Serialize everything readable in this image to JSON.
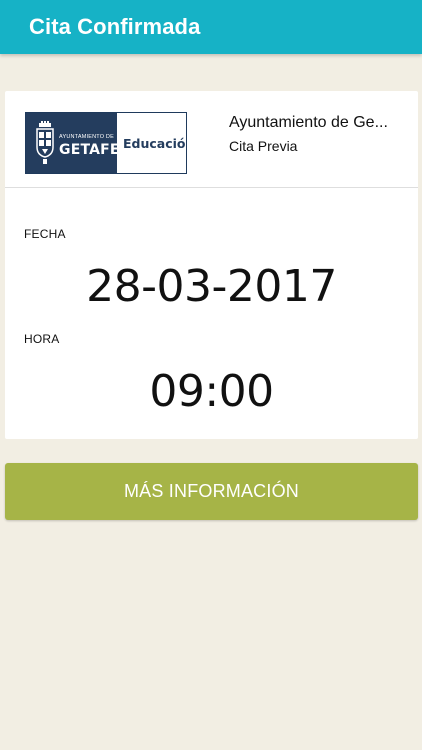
{
  "appbar": {
    "title": "Cita Confirmada",
    "color": "#16b2c6"
  },
  "card": {
    "logo": {
      "small_text": "AYUNTAMIENTO DE",
      "big_text": "GETAFE",
      "right_text": "Educación",
      "navy": "#243d5e"
    },
    "org_name": "Ayuntamiento de Ge...",
    "org_subtitle": "Cita Previa",
    "fecha_label": "FECHA",
    "fecha_value": "28-03-2017",
    "hora_label": "HORA",
    "hora_value": "09:00"
  },
  "more_info_button": {
    "label": "MÁS INFORMACIÓN",
    "color": "#a6b447"
  },
  "background_color": "#f2eee3"
}
